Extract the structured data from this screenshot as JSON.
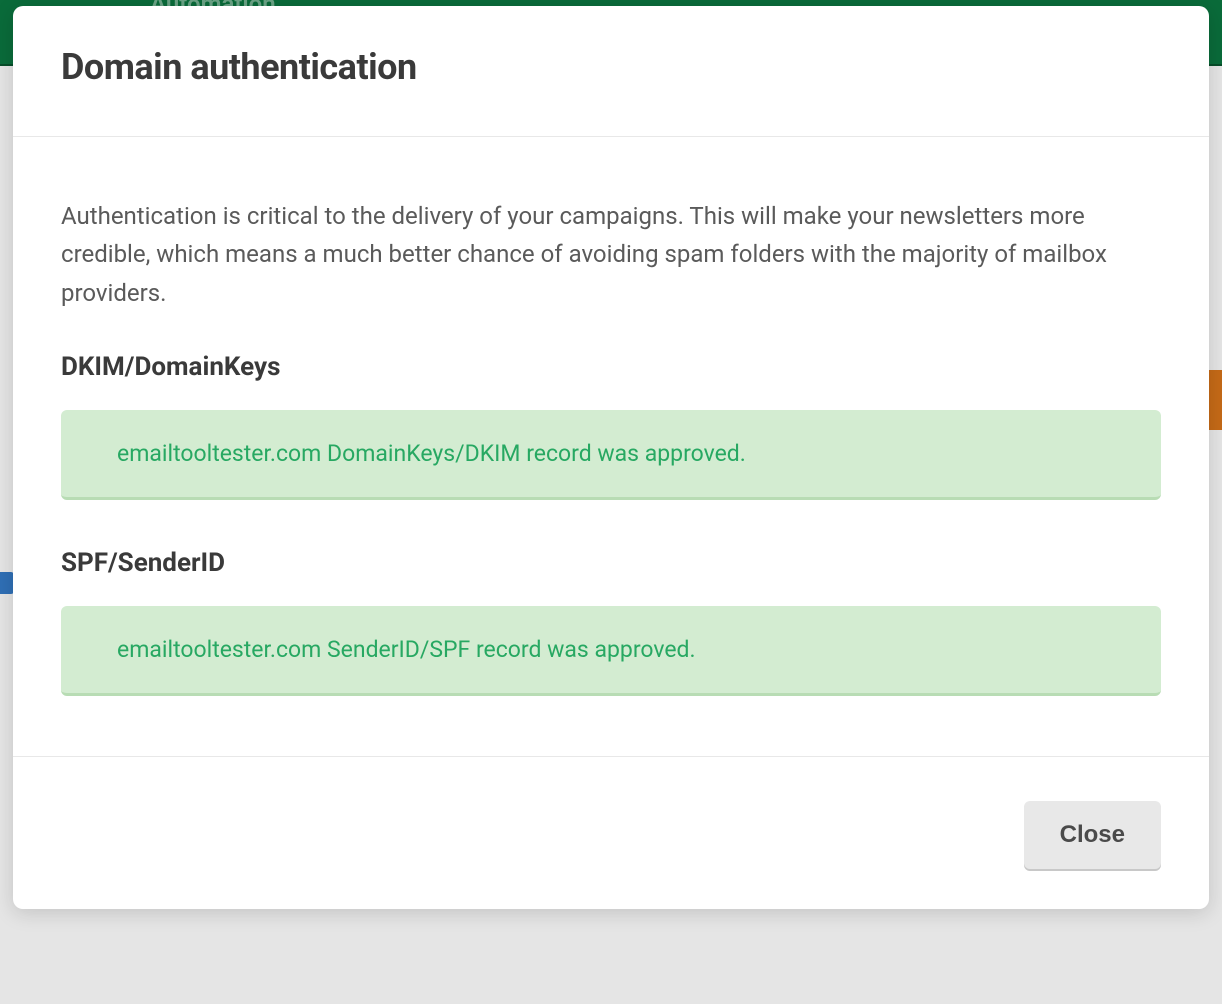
{
  "nav": {
    "item_label": "Automation"
  },
  "modal": {
    "title": "Domain authentication",
    "description": "Authentication is critical to the delivery of your campaigns. This will make your newsletters more credible, which means a much better chance of avoiding spam folders with the majority of mailbox providers.",
    "sections": [
      {
        "heading": "DKIM/DomainKeys",
        "status_message": "emailtooltester.com DomainKeys/DKIM record was approved."
      },
      {
        "heading": "SPF/SenderID",
        "status_message": "emailtooltester.com SenderID/SPF record was approved."
      }
    ],
    "close_label": "Close"
  }
}
